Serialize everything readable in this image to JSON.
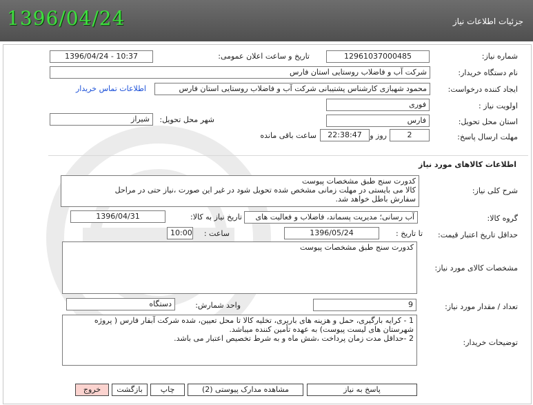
{
  "header": {
    "date": "1396/04/24",
    "title": "جزئیات اطلاعات نیاز"
  },
  "need_info": {
    "need_number_label": "شماره نیاز:",
    "need_number": "12961037000485",
    "announce_label": "تاریخ و ساعت اعلان عمومی:",
    "announce_value": "1396/04/24 - 10:37",
    "buyer_label": "نام دستگاه خریدار:",
    "buyer_value": "شرکت آب و فاضلاب روستایی استان فارس",
    "creator_label": "ایجاد کننده درخواست:",
    "creator_value": "محمود  شهبازی کارشناس پشتیبانی شرکت آب و فاضلاب روستایی استان فارس",
    "contact_link": "اطلاعات تماس خریدار",
    "priority_label": "اولویت نیاز :",
    "priority_value": "فوری",
    "province_label": "استان محل تحویل:",
    "province_value": "فارس",
    "city_label": "شهر محل تحویل:",
    "city_value": "شیراز",
    "deadline_label": "مهلت ارسال پاسخ:",
    "deadline_days": "2",
    "days_label": "روز و",
    "deadline_time": "22:38:47",
    "remaining_label": "ساعت باقی مانده"
  },
  "goods": {
    "section_title": "اطلاعات کالاهای مورد نیاز",
    "general_label": "شرح کلی نیاز:",
    "general_lines": [
      "کدورت سنج طبق مشخصات پیوست",
      "کالا می بایستی در مهلت زمانی مشخص شده تحویل شود در غیر این صورت ،نیاز حتی در مراحل",
      "سفارش باطل خواهد شد."
    ],
    "group_label": "گروه کالا:",
    "group_value": "آب رسانی؛ مدیریت پسماند، فاضلاب و فعالیت های",
    "need_date_label": "تاریخ نیاز به کالا:",
    "need_date": "1396/04/31",
    "min_validity_label": "حداقل تاریخ اعتبار قیمت:",
    "until_date_label": "تا تاریخ :",
    "until_date": "1396/05/24",
    "time_label": "ساعت :",
    "time_value": "10:00",
    "specs_label": "مشخصات کالای مورد نیاز:",
    "specs_value": "کدورت سنج طبق مشخصات پیوست",
    "qty_label": "تعداد / مقدار مورد نیاز:",
    "qty_value": "9",
    "unit_label": "واحد شمارش:",
    "unit_value": "دستگاه",
    "notes_label": "توضیحات خریدار:",
    "notes_lines": [
      "1 - کرایه بارگیری، حمل و هزینه های باربری، تخلیه کالا تا محل تعیین، شده شرکت آبفار فارس ( پروژه",
      "شهرستان های لیست پیوست) به عهده تأمین کننده میباشد.",
      "2 -حداقل مدت زمان پرداخت ،شش ماه و به شرط تخصیص اعتبار می باشد."
    ]
  },
  "buttons": {
    "reply": "پاسخ به نیاز",
    "attachments": "مشاهده مدارک پیوستی (2)",
    "print": "چاپ",
    "back": "بازگشت",
    "exit": "خروج"
  }
}
